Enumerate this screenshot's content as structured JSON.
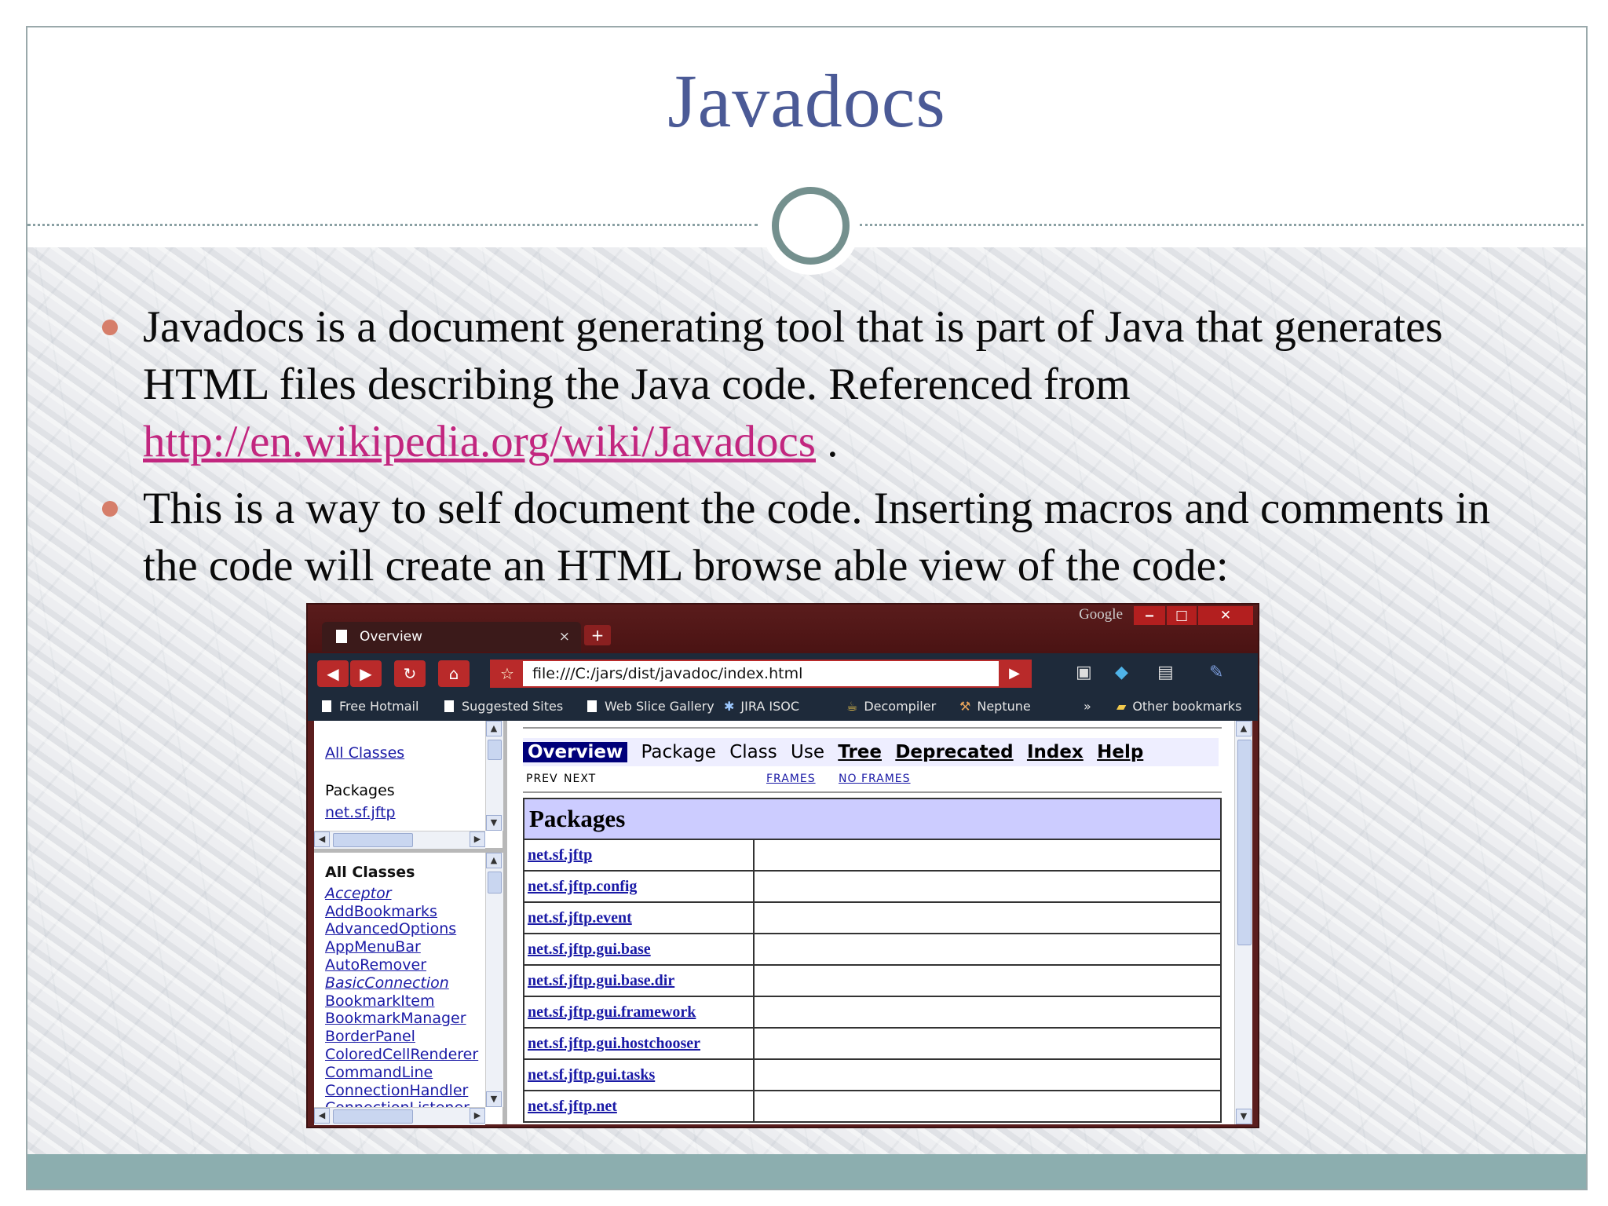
{
  "slide": {
    "title": "Javadocs",
    "bullets": [
      {
        "text": "Javadocs is a document generating tool that is part of Java that generates HTML files describing the Java code.  Referenced from ",
        "link": "http://en.wikipedia.org/wiki/Javadocs",
        "after": " ."
      },
      {
        "text": "This is a way to self document the code.  Inserting macros and comments in the code will create an HTML browse able view of the code:"
      }
    ],
    "colors": {
      "title": "#4b5a96",
      "bullet": "#d67e6a",
      "link": "#c2267f",
      "footer": "#8caeaf",
      "circle": "#74908e"
    }
  },
  "browser": {
    "tab_title": "Overview",
    "tab_close": "×",
    "new_tab": "+",
    "brand": "Google",
    "window_buttons": [
      "‒",
      "□",
      "✕"
    ],
    "url": "file:///C:/jars/dist/javadoc/index.html",
    "bookmarks": [
      "Free Hotmail",
      "Suggested Sites",
      "Web Slice Gallery",
      "JIRA ISOC",
      "Decompiler",
      "Neptune"
    ],
    "overflow": "»",
    "other_bookmarks": "Other bookmarks"
  },
  "javadoc": {
    "all_classes_link": "All Classes",
    "packages_label": "Packages",
    "package_link": "net.sf.jftp",
    "classes_header": "All Classes",
    "classes": [
      "Acceptor",
      "AddBookmarks",
      "AdvancedOptions",
      "AppMenuBar",
      "AutoRemover",
      "BasicConnection",
      "BookmarkItem",
      "BookmarkManager",
      "BorderPanel",
      "ColoredCellRenderer",
      "CommandLine",
      "ConnectionHandler",
      "ConnectionListener"
    ],
    "nav": {
      "overview": "Overview",
      "package": "Package",
      "class": "Class",
      "use": "Use",
      "tree": "Tree",
      "deprecated": "Deprecated",
      "index": "Index",
      "help": "Help"
    },
    "prev": "PREV",
    "next": "NEXT",
    "frames": "FRAMES",
    "no_frames": "NO FRAMES",
    "packages_header": "Packages",
    "packages": [
      "net.sf.jftp",
      "net.sf.jftp.config",
      "net.sf.jftp.event",
      "net.sf.jftp.gui.base",
      "net.sf.jftp.gui.base.dir",
      "net.sf.jftp.gui.framework",
      "net.sf.jftp.gui.hostchooser",
      "net.sf.jftp.gui.tasks",
      "net.sf.jftp.net"
    ]
  }
}
